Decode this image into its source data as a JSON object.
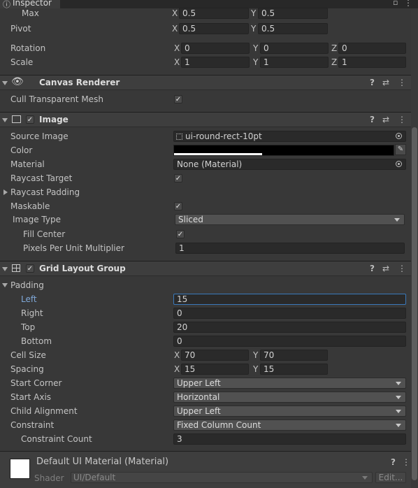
{
  "window": {
    "tab_label": "Inspector"
  },
  "rect_transform": {
    "max_label": "Max",
    "max_x": "0.5",
    "max_y": "0.5",
    "pivot_label": "Pivot",
    "pivot_x": "0.5",
    "pivot_y": "0.5",
    "rotation_label": "Rotation",
    "rotation_x": "0",
    "rotation_y": "0",
    "rotation_z": "0",
    "scale_label": "Scale",
    "scale_x": "1",
    "scale_y": "1",
    "scale_z": "1"
  },
  "axes": {
    "x": "X",
    "y": "Y",
    "z": "Z"
  },
  "canvas_renderer": {
    "title": "Canvas Renderer",
    "cull_label": "Cull Transparent Mesh",
    "cull_checked": true
  },
  "image": {
    "title": "Image",
    "enabled": true,
    "source_image_label": "Source Image",
    "source_image_value": "ui-round-rect-10pt",
    "color_label": "Color",
    "color_value": "#000000",
    "color_alpha_percent": 40,
    "material_label": "Material",
    "material_value": "None (Material)",
    "raycast_target_label": "Raycast Target",
    "raycast_target_checked": true,
    "raycast_padding_label": "Raycast Padding",
    "maskable_label": "Maskable",
    "maskable_checked": true,
    "image_type_label": "Image Type",
    "image_type_value": "Sliced",
    "fill_center_label": "Fill Center",
    "fill_center_checked": true,
    "ppu_label": "Pixels Per Unit Multiplier",
    "ppu_value": "1"
  },
  "grid": {
    "title": "Grid Layout Group",
    "enabled": true,
    "padding_label": "Padding",
    "left_label": "Left",
    "left_value": "15",
    "right_label": "Right",
    "right_value": "0",
    "top_label": "Top",
    "top_value": "20",
    "bottom_label": "Bottom",
    "bottom_value": "0",
    "cell_size_label": "Cell Size",
    "cell_x": "70",
    "cell_y": "70",
    "spacing_label": "Spacing",
    "spacing_x": "15",
    "spacing_y": "15",
    "start_corner_label": "Start Corner",
    "start_corner_value": "Upper Left",
    "start_axis_label": "Start Axis",
    "start_axis_value": "Horizontal",
    "child_alignment_label": "Child Alignment",
    "child_alignment_value": "Upper Left",
    "constraint_label": "Constraint",
    "constraint_value": "Fixed Column Count",
    "constraint_count_label": "Constraint Count",
    "constraint_count_value": "3"
  },
  "material": {
    "title": "Default UI Material (Material)",
    "shader_label": "Shader",
    "shader_value": "UI/Default",
    "edit_label": "Edit..."
  },
  "icons": {
    "help": "?",
    "presets": "⇄",
    "more": "⋮",
    "check": "✓"
  },
  "colors": {
    "accent": "#3a79bb",
    "field_bg": "#2a2a2a",
    "panel_bg": "#383838"
  }
}
